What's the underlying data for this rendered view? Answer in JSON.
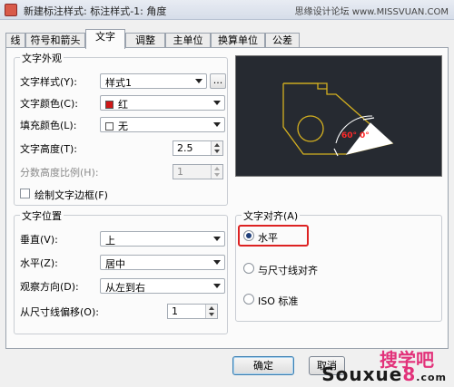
{
  "window": {
    "title": "新建标注样式: 标注样式-1: 角度",
    "watermark": "思缘设计论坛 www.MISSVUAN.COM"
  },
  "tabs": [
    {
      "label": "线",
      "active": false
    },
    {
      "label": "符号和箭头",
      "active": false
    },
    {
      "label": "文字",
      "active": true
    },
    {
      "label": "调整",
      "active": false
    },
    {
      "label": "主单位",
      "active": false
    },
    {
      "label": "换算单位",
      "active": false
    },
    {
      "label": "公差",
      "active": false
    }
  ],
  "appearance": {
    "group_title": "文字外观",
    "style_label": "文字样式(Y):",
    "style_value": "样式1",
    "style_browse": "...",
    "color_label": "文字颜色(C):",
    "color_value": "红",
    "color_swatch": "#d01818",
    "fill_label": "填充颜色(L):",
    "fill_value": "无",
    "height_label": "文字高度(T):",
    "height_value": "2.5",
    "fraction_label": "分数高度比例(H):",
    "fraction_value": "1",
    "frame_label": "绘制文字边框(F)"
  },
  "placement": {
    "group_title": "文字位置",
    "vertical_label": "垂直(V):",
    "vertical_value": "上",
    "horizontal_label": "水平(Z):",
    "horizontal_value": "居中",
    "direction_label": "观察方向(D):",
    "direction_value": "从左到右",
    "offset_label": "从尺寸线偏移(O):",
    "offset_value": "1"
  },
  "alignment": {
    "group_title": "文字对齐(A)",
    "options": [
      {
        "label": "水平",
        "selected": true
      },
      {
        "label": "与尺寸线对齐",
        "selected": false
      },
      {
        "label": "ISO 标准",
        "selected": false
      }
    ]
  },
  "preview": {
    "angle_text": "60°",
    "zero_text": "0°",
    "line_color": "#d4b020",
    "dim_color": "#ffffff",
    "text_color": "#ff2a2a"
  },
  "buttons": {
    "ok": "确定",
    "cancel": "取消"
  },
  "logo": {
    "line1": "搜学吧",
    "line2a": "Souxue",
    "line2b": "8",
    "line2c": ".com"
  }
}
